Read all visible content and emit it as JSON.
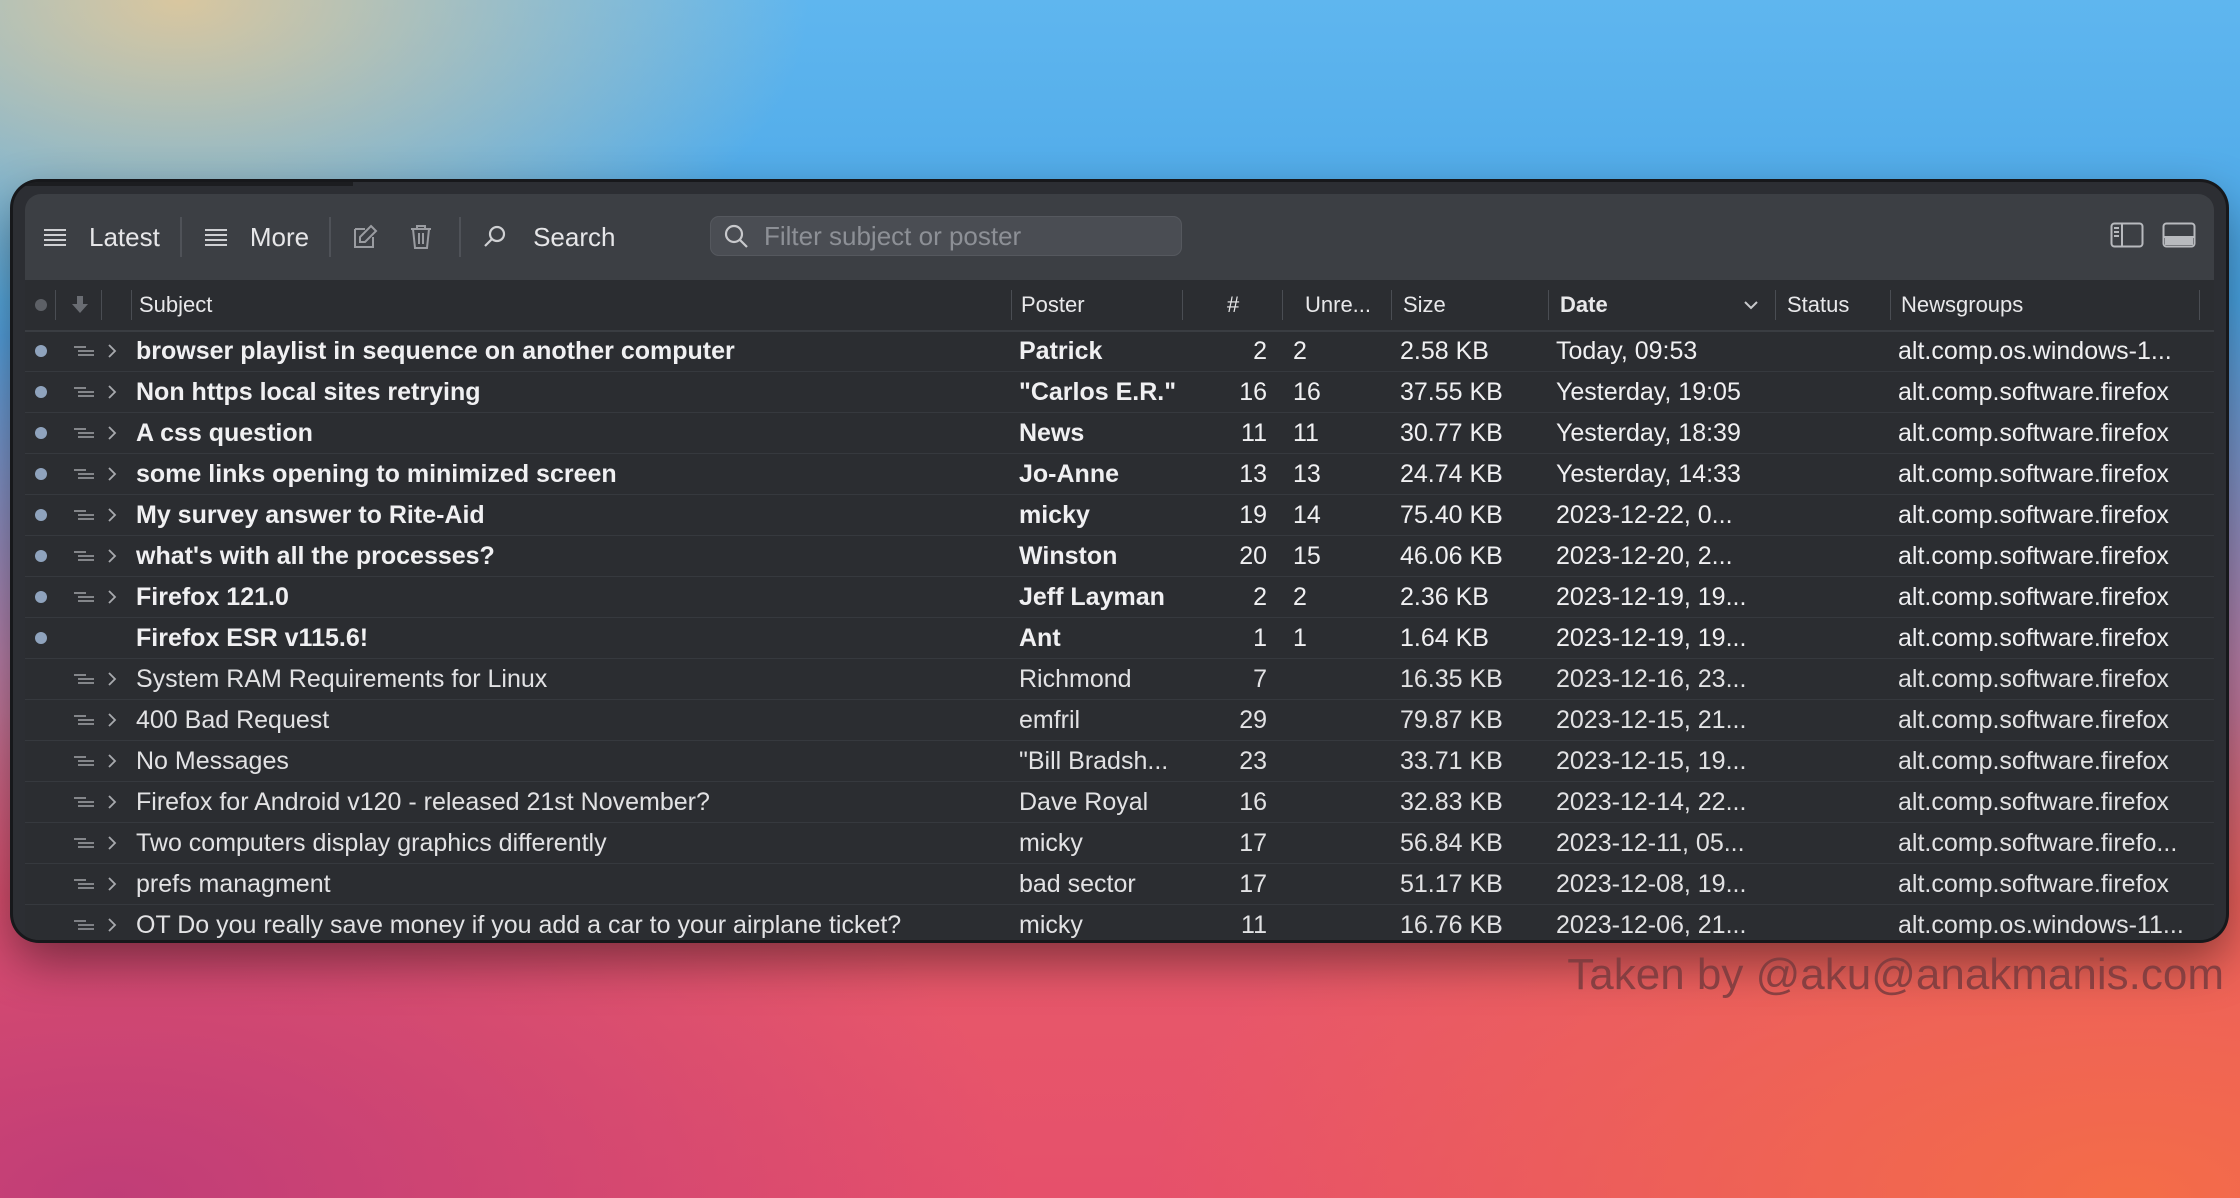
{
  "toolbar": {
    "latest_label": "Latest",
    "more_label": "More",
    "search_label": "Search",
    "filter_placeholder": "Filter subject or poster"
  },
  "columns": {
    "subject": "Subject",
    "poster": "Poster",
    "count": "#",
    "unread": "Unre...",
    "size": "Size",
    "date": "Date",
    "status": "Status",
    "newsgroups": "Newsgroups"
  },
  "rows": [
    {
      "unread": true,
      "thread": true,
      "subject": "browser playlist in sequence on another computer",
      "poster": "Patrick",
      "count": "2",
      "unread_count": "2",
      "size": "2.58 KB",
      "date": "Today, 09:53",
      "status": "",
      "group": "alt.comp.os.windows-1..."
    },
    {
      "unread": true,
      "thread": true,
      "subject": "Non https local sites retrying",
      "poster": "\"Carlos E.R.\"",
      "count": "16",
      "unread_count": "16",
      "size": "37.55 KB",
      "date": "Yesterday, 19:05",
      "status": "",
      "group": "alt.comp.software.firefox"
    },
    {
      "unread": true,
      "thread": true,
      "subject": "A css question",
      "poster": "News",
      "count": "11",
      "unread_count": "11",
      "size": "30.77 KB",
      "date": "Yesterday, 18:39",
      "status": "",
      "group": "alt.comp.software.firefox"
    },
    {
      "unread": true,
      "thread": true,
      "subject": "some links opening to minimized screen",
      "poster": "Jo-Anne",
      "count": "13",
      "unread_count": "13",
      "size": "24.74 KB",
      "date": "Yesterday, 14:33",
      "status": "",
      "group": "alt.comp.software.firefox"
    },
    {
      "unread": true,
      "thread": true,
      "subject": "My  survey answer to Rite-Aid",
      "poster": "micky",
      "count": "19",
      "unread_count": "14",
      "size": "75.40 KB",
      "date": "2023-12-22, 0...",
      "status": "",
      "group": "alt.comp.software.firefox"
    },
    {
      "unread": true,
      "thread": true,
      "subject": "what's with all the processes?",
      "poster": "Winston",
      "count": "20",
      "unread_count": "15",
      "size": "46.06 KB",
      "date": "2023-12-20, 2...",
      "status": "",
      "group": "alt.comp.software.firefox"
    },
    {
      "unread": true,
      "thread": true,
      "subject": "Firefox 121.0",
      "poster": "Jeff Layman",
      "count": "2",
      "unread_count": "2",
      "size": "2.36 KB",
      "date": "2023-12-19, 19...",
      "status": "",
      "group": "alt.comp.software.firefox"
    },
    {
      "unread": true,
      "thread": false,
      "subject": "Firefox ESR v115.6!",
      "poster": "Ant",
      "count": "1",
      "unread_count": "1",
      "size": "1.64 KB",
      "date": "2023-12-19, 19...",
      "status": "",
      "group": "alt.comp.software.firefox"
    },
    {
      "unread": false,
      "thread": true,
      "subject": "System RAM Requirements for Linux",
      "poster": "Richmond",
      "count": "7",
      "unread_count": "",
      "size": "16.35 KB",
      "date": "2023-12-16, 23...",
      "status": "",
      "group": "alt.comp.software.firefox"
    },
    {
      "unread": false,
      "thread": true,
      "subject": "400 Bad Request",
      "poster": "emfril",
      "count": "29",
      "unread_count": "",
      "size": "79.87 KB",
      "date": "2023-12-15, 21...",
      "status": "",
      "group": "alt.comp.software.firefox"
    },
    {
      "unread": false,
      "thread": true,
      "subject": "No Messages",
      "poster": "\"Bill Bradsh...",
      "count": "23",
      "unread_count": "",
      "size": "33.71 KB",
      "date": "2023-12-15, 19...",
      "status": "",
      "group": "alt.comp.software.firefox"
    },
    {
      "unread": false,
      "thread": true,
      "subject": "Firefox for Android v120 - released 21st November?",
      "poster": "Dave Royal",
      "count": "16",
      "unread_count": "",
      "size": "32.83 KB",
      "date": "2023-12-14, 22...",
      "status": "",
      "group": "alt.comp.software.firefox"
    },
    {
      "unread": false,
      "thread": true,
      "subject": "Two computers display graphics differently",
      "poster": "micky",
      "count": "17",
      "unread_count": "",
      "size": "56.84 KB",
      "date": "2023-12-11, 05...",
      "status": "",
      "group": "alt.comp.software.firefo..."
    },
    {
      "unread": false,
      "thread": true,
      "subject": "prefs managment",
      "poster": "bad sector",
      "count": "17",
      "unread_count": "",
      "size": "51.17 KB",
      "date": "2023-12-08, 19...",
      "status": "",
      "group": "alt.comp.software.firefox"
    },
    {
      "unread": false,
      "thread": true,
      "subject": "OT   Do you really save money if you add a car to your airplane ticket?",
      "poster": "micky",
      "count": "11",
      "unread_count": "",
      "size": "16.76 KB",
      "date": "2023-12-06, 21...",
      "status": "",
      "group": "alt.comp.os.windows-11..."
    }
  ],
  "watermark": "Taken by @aku@anakmanis.com",
  "colors": {
    "unread_dot": "#8fa3bd",
    "toolbar": "#3c3f44",
    "list_bg": "#2b2d31"
  }
}
